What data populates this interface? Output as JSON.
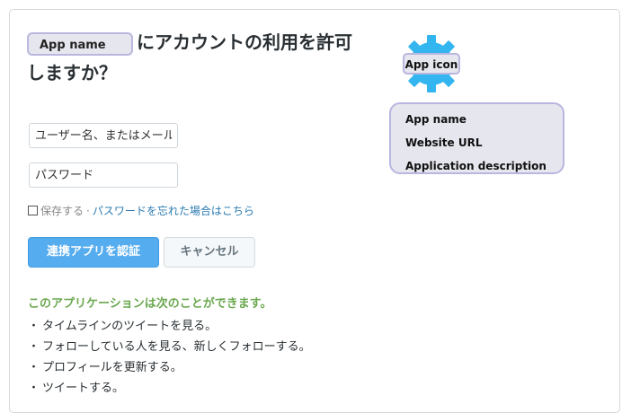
{
  "header": {
    "app_name_placeholder": "App name",
    "title_suffix": "にアカウントの利用を許可しますか？"
  },
  "login": {
    "username_placeholder": "ユーザー名、またはメールアドレス",
    "password_placeholder": "パスワード",
    "remember_label": "保存する",
    "separator": "·",
    "forgot_link": "パスワードを忘れた場合はこちら"
  },
  "actions": {
    "authorize_label": "連携アプリを認証",
    "cancel_label": "キャンセル"
  },
  "permissions": {
    "title": "このアプリケーションは次のことができます。",
    "bullet": "・",
    "items": [
      "タイムラインのツイートを見る。",
      "フォローしている人を見る、新しくフォローする。",
      "プロフィールを更新する。",
      "ツイートする。"
    ]
  },
  "app": {
    "icon_label": "App icon",
    "icon_name": "gear-icon",
    "icon_color": "#33b5f0",
    "info_name": "App name",
    "info_website": "Website URL",
    "info_description": "Application description"
  },
  "colors": {
    "primary_button": "#55acee",
    "permission_title": "#6aa84f",
    "link": "#2c7bb0",
    "placeholder_fill": "#e6e6ee",
    "placeholder_border": "#b9b6e0"
  }
}
